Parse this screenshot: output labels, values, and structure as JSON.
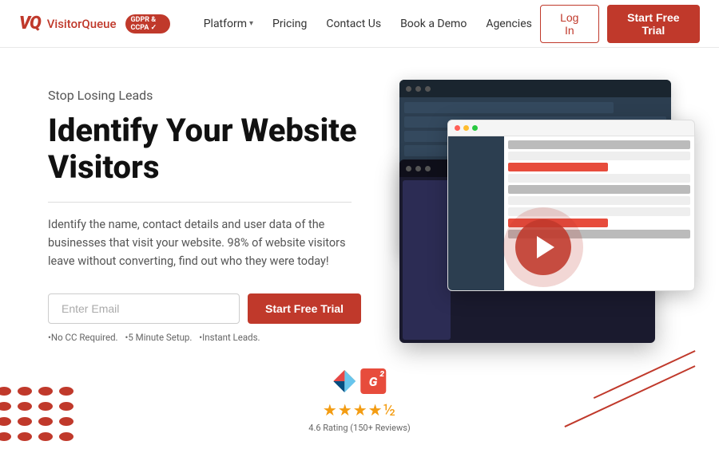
{
  "brand": {
    "logo_vq": "VQ",
    "logo_name": "Visitor",
    "logo_name2": "Queue",
    "gdpr_badge": "GDPR & CCPA ✓"
  },
  "nav": {
    "platform_label": "Platform",
    "pricing_label": "Pricing",
    "contact_label": "Contact Us",
    "demo_label": "Book a Demo",
    "agencies_label": "Agencies",
    "login_label": "Log In",
    "trial_label": "Start Free Trial"
  },
  "hero": {
    "subtitle": "Stop Losing Leads",
    "title_line1": "Identify Your Website",
    "title_line2": "Visitors",
    "description": "Identify the name, contact details and user data of the businesses that visit your website. 98% of website visitors leave without converting, find out who they were today!",
    "email_placeholder": "Enter Email",
    "trial_btn_label": "Start Free Trial",
    "note_cc": "•No CC Required.",
    "note_setup": "•5 Minute Setup.",
    "note_leads": "•Instant Leads."
  },
  "rating": {
    "stars": "★★★★½",
    "text": "4.6 Rating (150+ Reviews)"
  }
}
